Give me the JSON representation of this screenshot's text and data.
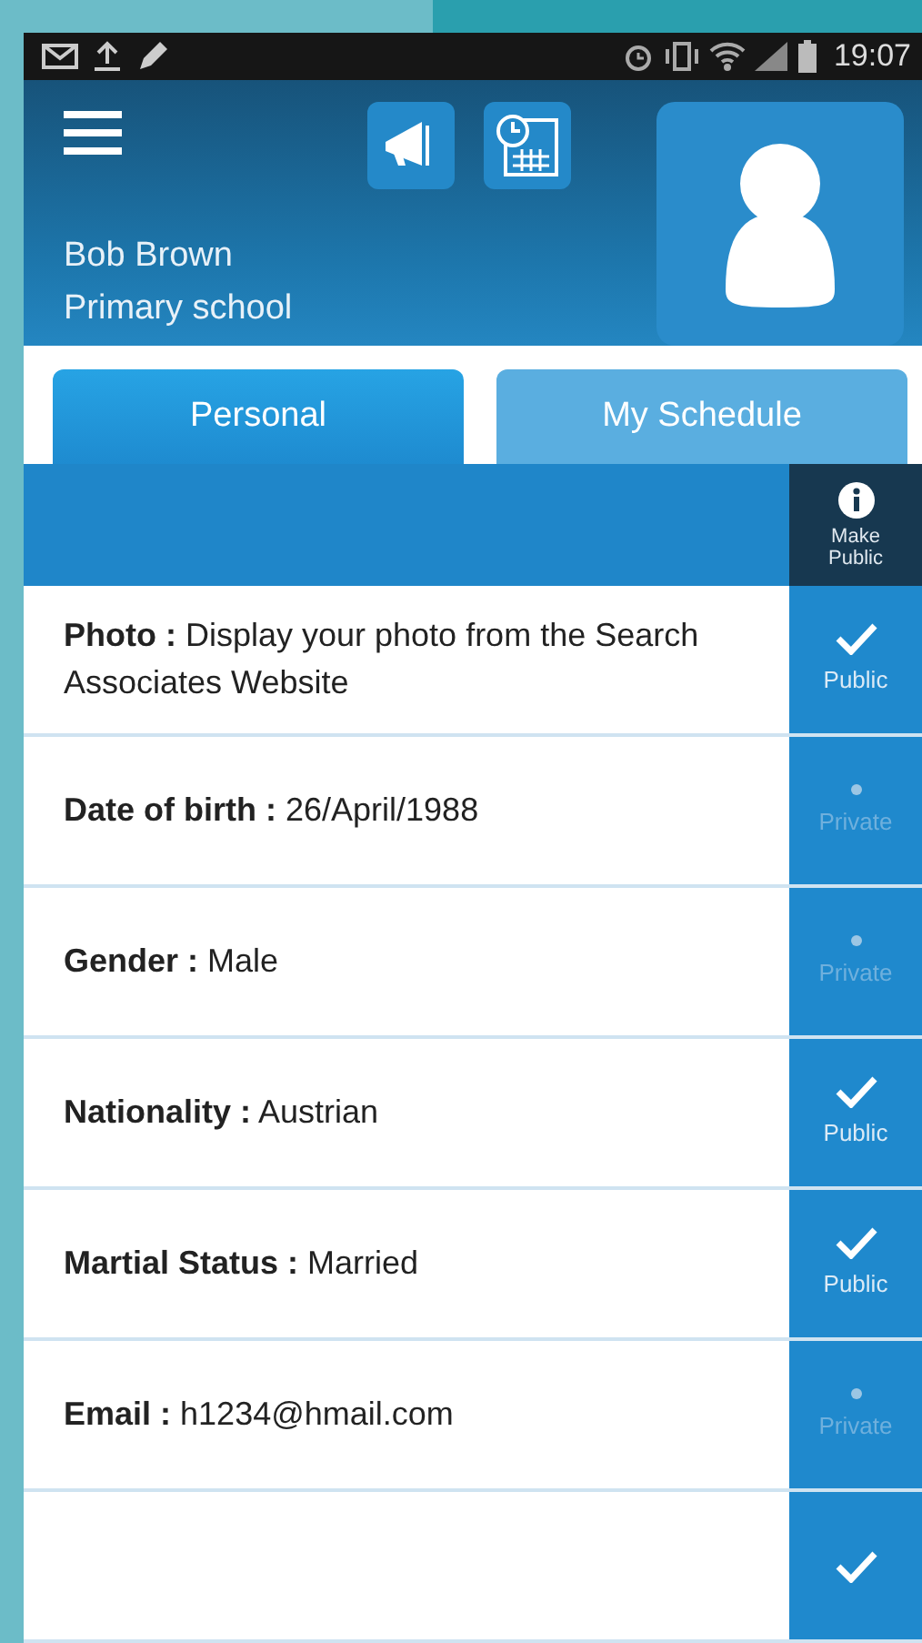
{
  "status_bar": {
    "time": "19:07"
  },
  "header": {
    "name": "Bob Brown",
    "school": "Primary school"
  },
  "tabs": [
    {
      "label": "Personal",
      "selected": true
    },
    {
      "label": "My Schedule",
      "selected": false
    }
  ],
  "column_header": {
    "label": "Make Public"
  },
  "fields": [
    {
      "text": "**Photo :** Display your photo from the Search Associates Website",
      "public": true,
      "status": "Public"
    },
    {
      "text": "**Date of birth :** 26/April/1988",
      "public": false,
      "status": "Private"
    },
    {
      "text": "**Gender :** Male",
      "public": false,
      "status": "Private"
    },
    {
      "text": "**Nationality :** Austrian",
      "public": true,
      "status": "Public"
    },
    {
      "text": "**Martial Status :** Married",
      "public": true,
      "status": "Public"
    },
    {
      "text": "**Email :** h1234@hmail.com",
      "public": false,
      "status": "Private"
    },
    {
      "public": true
    }
  ]
}
